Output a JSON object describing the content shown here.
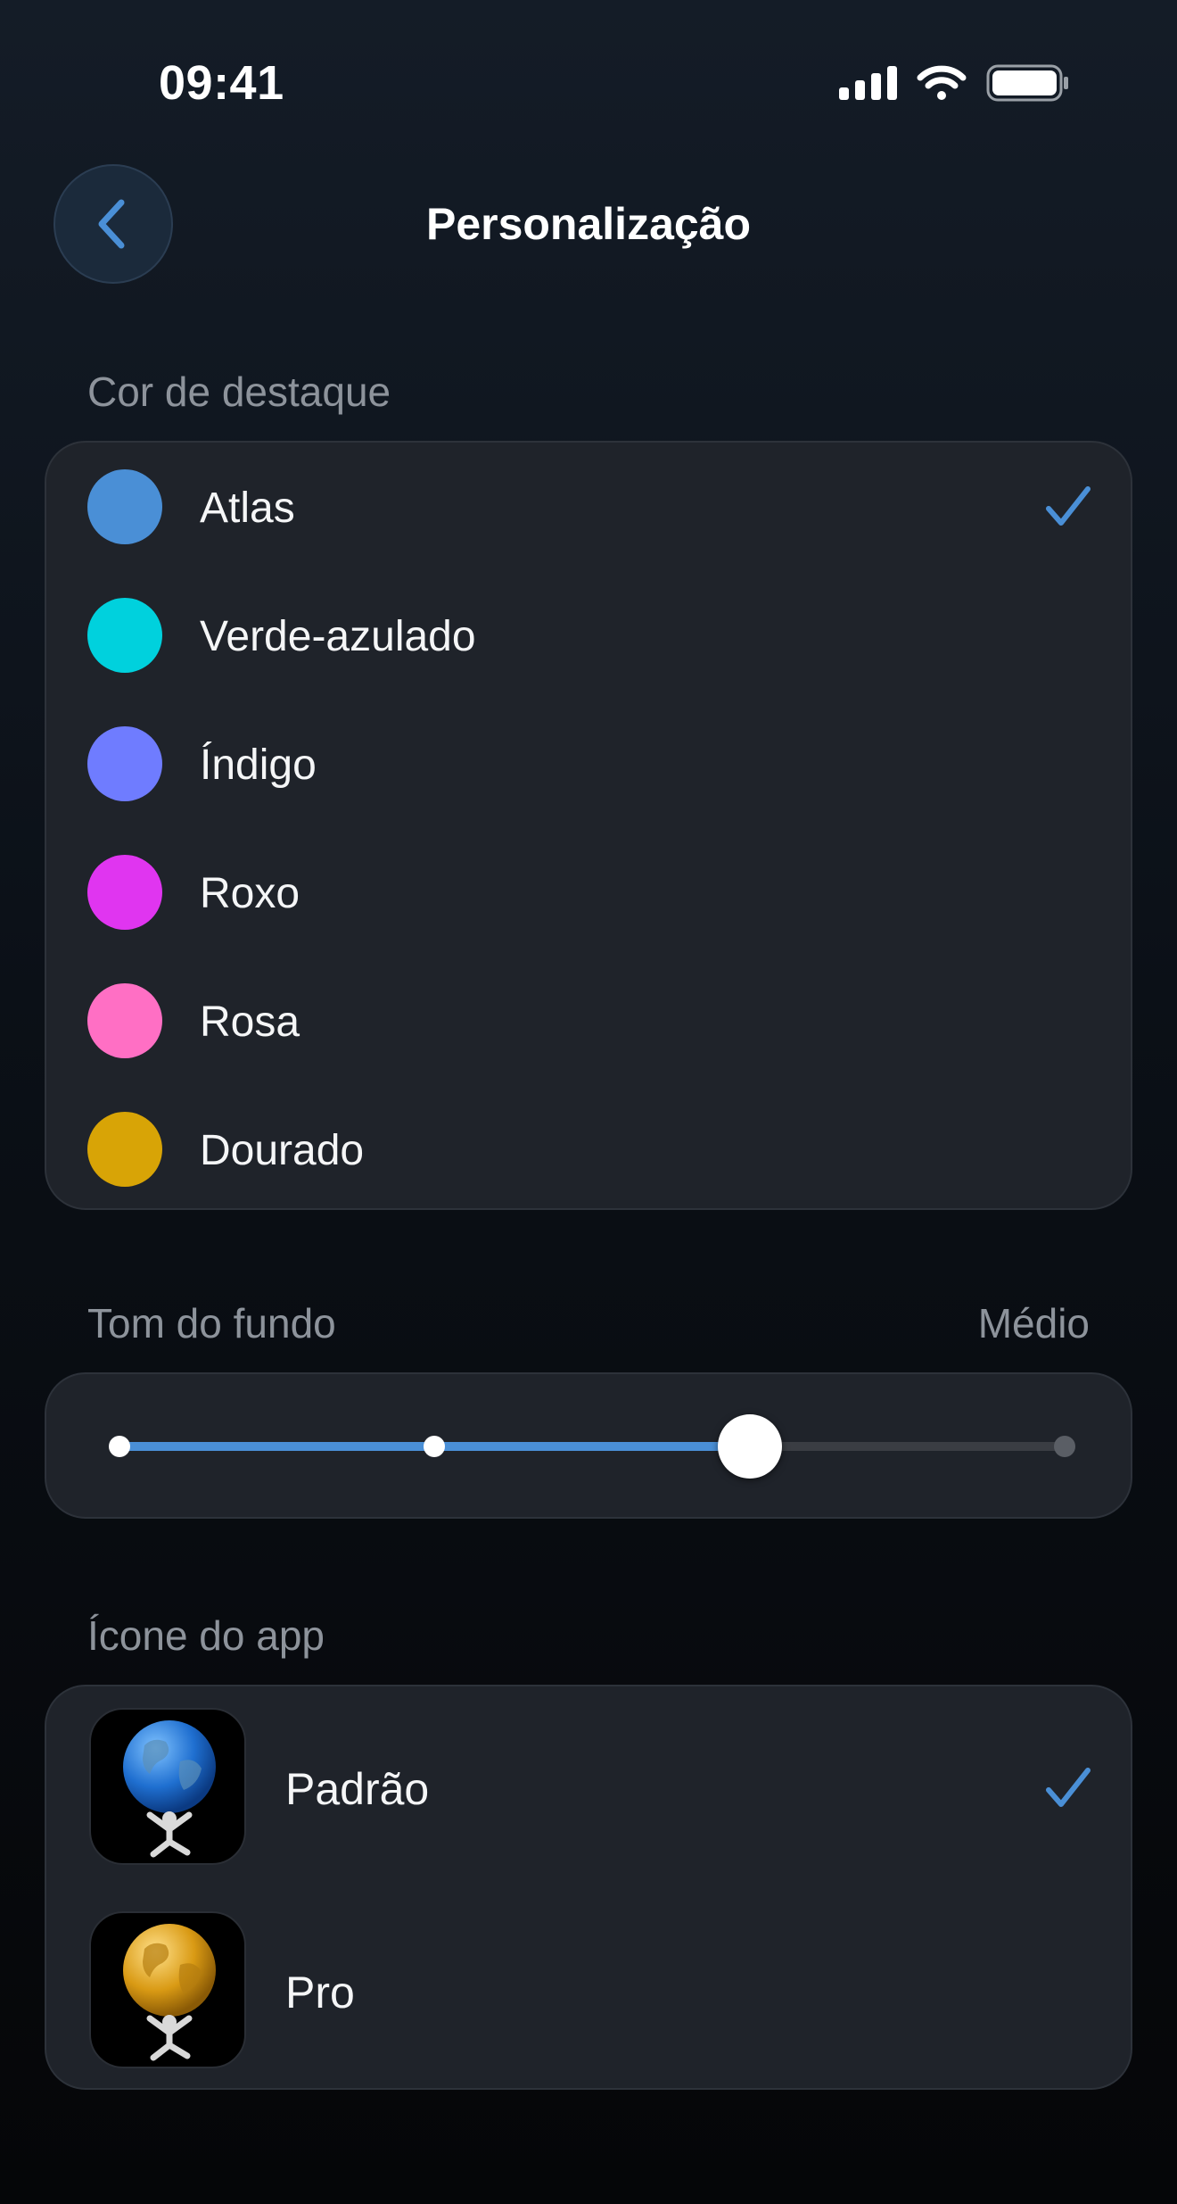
{
  "status_bar": {
    "time": "09:41"
  },
  "header": {
    "title": "Personalização",
    "back_icon": "chevron-left-icon"
  },
  "accent_section": {
    "label": "Cor de destaque",
    "selected": "Atlas",
    "options": [
      {
        "label": "Atlas",
        "color": "#4a8fd6",
        "selected": true
      },
      {
        "label": "Verde-azulado",
        "color": "#00d1dd",
        "selected": false
      },
      {
        "label": "Índigo",
        "color": "#6f7cff",
        "selected": false
      },
      {
        "label": "Roxo",
        "color": "#e035f0",
        "selected": false
      },
      {
        "label": "Rosa",
        "color": "#ff6fc4",
        "selected": false
      },
      {
        "label": "Dourado",
        "color": "#d8a406",
        "selected": false
      }
    ]
  },
  "background_section": {
    "label": "Tom do fundo",
    "value": "Médio",
    "steps": 4,
    "selected_step": 2
  },
  "icon_section": {
    "label": "Ícone do app",
    "options": [
      {
        "label": "Padrão",
        "icon": "atlas-blue-globe-icon",
        "selected": true
      },
      {
        "label": "Pro",
        "icon": "atlas-gold-globe-icon",
        "selected": false
      }
    ]
  },
  "colors": {
    "accent": "#4a8fd6",
    "card": "#1f232a",
    "muted_text": "#8d939b"
  }
}
